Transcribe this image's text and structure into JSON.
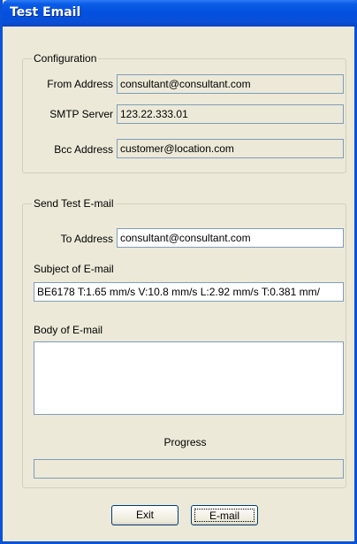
{
  "window": {
    "title": "Test Email"
  },
  "configuration": {
    "label": "Configuration",
    "from_label": "From Address",
    "from_value": "consultant@consultant.com",
    "smtp_label": "SMTP Server",
    "smtp_value": "123.22.333.01",
    "bcc_label": "Bcc Address",
    "bcc_value": "customer@location.com"
  },
  "send": {
    "label": "Send Test E-mail",
    "to_label": "To Address",
    "to_value": "consultant@consultant.com",
    "subject_label": "Subject of E-mail",
    "subject_value": "BE6178  T:1.65 mm/s  V:10.8 mm/s  L:2.92 mm/s  T:0.381 mm/",
    "body_label": "Body of E-mail",
    "body_value": "",
    "progress_label": "Progress",
    "progress_fraction": 0
  },
  "buttons": {
    "exit": "Exit",
    "email": "E-mail"
  }
}
